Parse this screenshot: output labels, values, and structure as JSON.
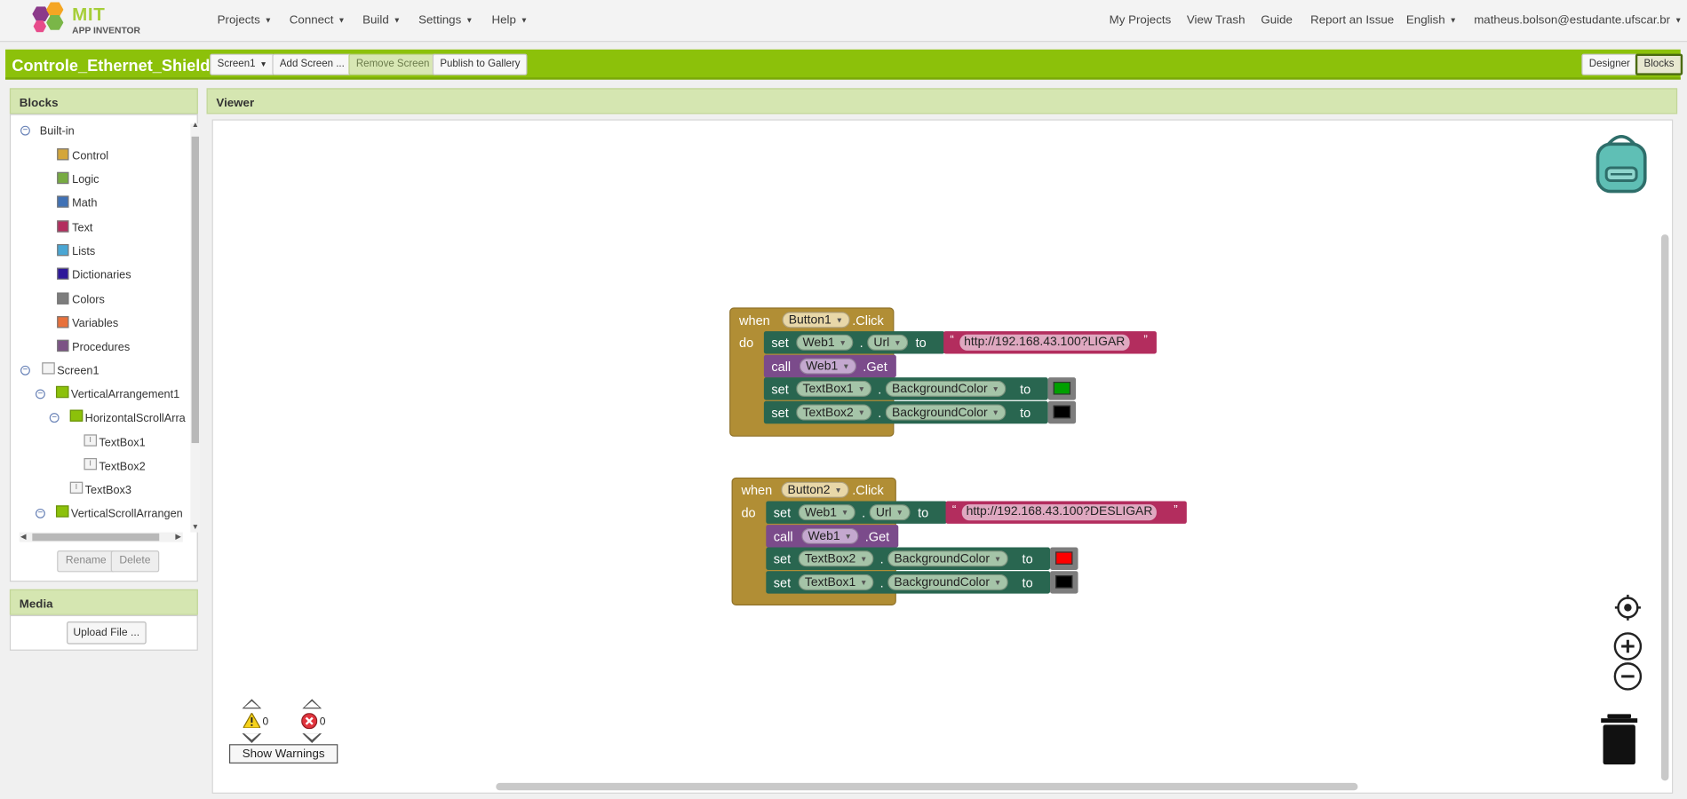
{
  "header": {
    "logo_top": "MIT",
    "logo_bottom": "APP INVENTOR",
    "menus": [
      "Projects",
      "Connect",
      "Build",
      "Settings",
      "Help"
    ],
    "right_links": [
      "My Projects",
      "View Trash",
      "Guide",
      "Report an Issue"
    ],
    "language": "English",
    "user_email": "matheus.bolson@estudante.ufscar.br"
  },
  "project": {
    "name": "Controle_Ethernet_Shield",
    "screen_select": "Screen1",
    "add_screen": "Add Screen ...",
    "remove_screen": "Remove Screen",
    "publish": "Publish to Gallery",
    "designer": "Designer",
    "blocks": "Blocks"
  },
  "blocks_panel": {
    "title": "Blocks",
    "builtin": "Built-in",
    "categories": [
      {
        "label": "Control",
        "color": "#d4a63a"
      },
      {
        "label": "Logic",
        "color": "#77ab41"
      },
      {
        "label": "Math",
        "color": "#3f71b5"
      },
      {
        "label": "Text",
        "color": "#b32d5e"
      },
      {
        "label": "Lists",
        "color": "#49a6d4"
      },
      {
        "label": "Dictionaries",
        "color": "#2d1799"
      },
      {
        "label": "Colors",
        "color": "#7d7d7d"
      },
      {
        "label": "Variables",
        "color": "#e8703a"
      },
      {
        "label": "Procedures",
        "color": "#7c5385"
      }
    ],
    "components": [
      "Screen1",
      "VerticalArrangement1",
      "HorizontalScrollArra",
      "TextBox1",
      "TextBox2",
      "TextBox3",
      "VerticalScrollArrangen"
    ],
    "rename": "Rename",
    "delete": "Delete"
  },
  "media_panel": {
    "title": "Media",
    "upload": "Upload File ..."
  },
  "viewer": {
    "title": "Viewer",
    "event1": {
      "when": "when",
      "component": "Button1",
      "event": ".Click",
      "do": "do",
      "url_component": "Web1",
      "url_prop": "Url",
      "url": "http://192.168.43.100?LIGAR",
      "call_component": "Web1",
      "call_method": ".Get",
      "set1_component": "TextBox1",
      "set1_prop": "BackgroundColor",
      "set1_color": "#00a000",
      "set2_component": "TextBox2",
      "set2_prop": "BackgroundColor",
      "set2_color": "#000000"
    },
    "event2": {
      "when": "when",
      "component": "Button2",
      "event": ".Click",
      "do": "do",
      "url_component": "Web1",
      "url_prop": "Url",
      "url": "http://192.168.43.100?DESLIGAR",
      "call_component": "Web1",
      "call_method": ".Get",
      "set1_component": "TextBox2",
      "set1_prop": "BackgroundColor",
      "set1_color": "#ff0000",
      "set2_component": "TextBox1",
      "set2_prop": "BackgroundColor",
      "set2_color": "#000000"
    },
    "kw": {
      "set": "set",
      "call": "call",
      "to": "to",
      "dot": "."
    },
    "warnings_count": "0",
    "errors_count": "0",
    "show_warnings": "Show Warnings"
  }
}
